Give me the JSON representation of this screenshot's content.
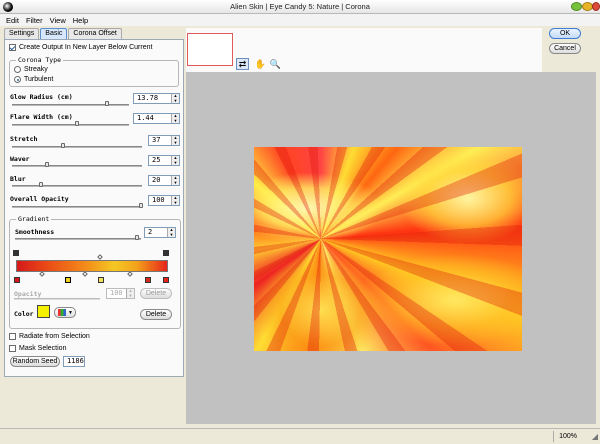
{
  "window": {
    "title": "Alien Skin | Eye Candy 5: Nature | Corona"
  },
  "menu": {
    "items": [
      "Edit",
      "Filter",
      "View",
      "Help"
    ]
  },
  "tabs": [
    "Settings",
    "Basic",
    "Corona Offset"
  ],
  "options": {
    "create_layer_label": "Create Output In New Layer Below Current",
    "create_layer_checked": true,
    "corona_type_legend": "Corona Type",
    "corona_types": [
      "Streaky",
      "Turbulent"
    ],
    "corona_type_selected": "Turbulent"
  },
  "params": [
    {
      "label": "Glow Radius (cm)",
      "value": "13.78",
      "level": 0.55
    },
    {
      "label": "Flare Width (cm)",
      "value": "1.44",
      "level": 0.38
    },
    {
      "label": "Stretch",
      "value": "37",
      "level": 0.37
    },
    {
      "label": "Waver",
      "value": "25",
      "level": 0.25
    },
    {
      "label": "Blur",
      "value": "20",
      "level": 0.2
    },
    {
      "label": "Overall Opacity",
      "value": "100",
      "level": 1.0
    }
  ],
  "gradient": {
    "legend": "Gradient",
    "smoothness_label": "Smoothness",
    "smoothness_value": "2",
    "smoothness_level": 0.95,
    "opacity_label": "Opacity",
    "opacity_value": "100",
    "delete_opacity_label": "Delete",
    "color_label": "Color",
    "color_value": "#f4f000",
    "delete_color_label": "Delete"
  },
  "checkboxes": [
    {
      "label": "Radiate from Selection",
      "checked": false
    },
    {
      "label": "Mask Selection",
      "checked": false
    }
  ],
  "random_seed": {
    "button_label": "Random Seed",
    "value": "1186"
  },
  "buttons": {
    "ok": "OK",
    "cancel": "Cancel"
  },
  "status": {
    "zoom": "100%"
  },
  "colors": {
    "accent": "#3d7bd4",
    "canvas_bg": "#c1c1c1"
  }
}
